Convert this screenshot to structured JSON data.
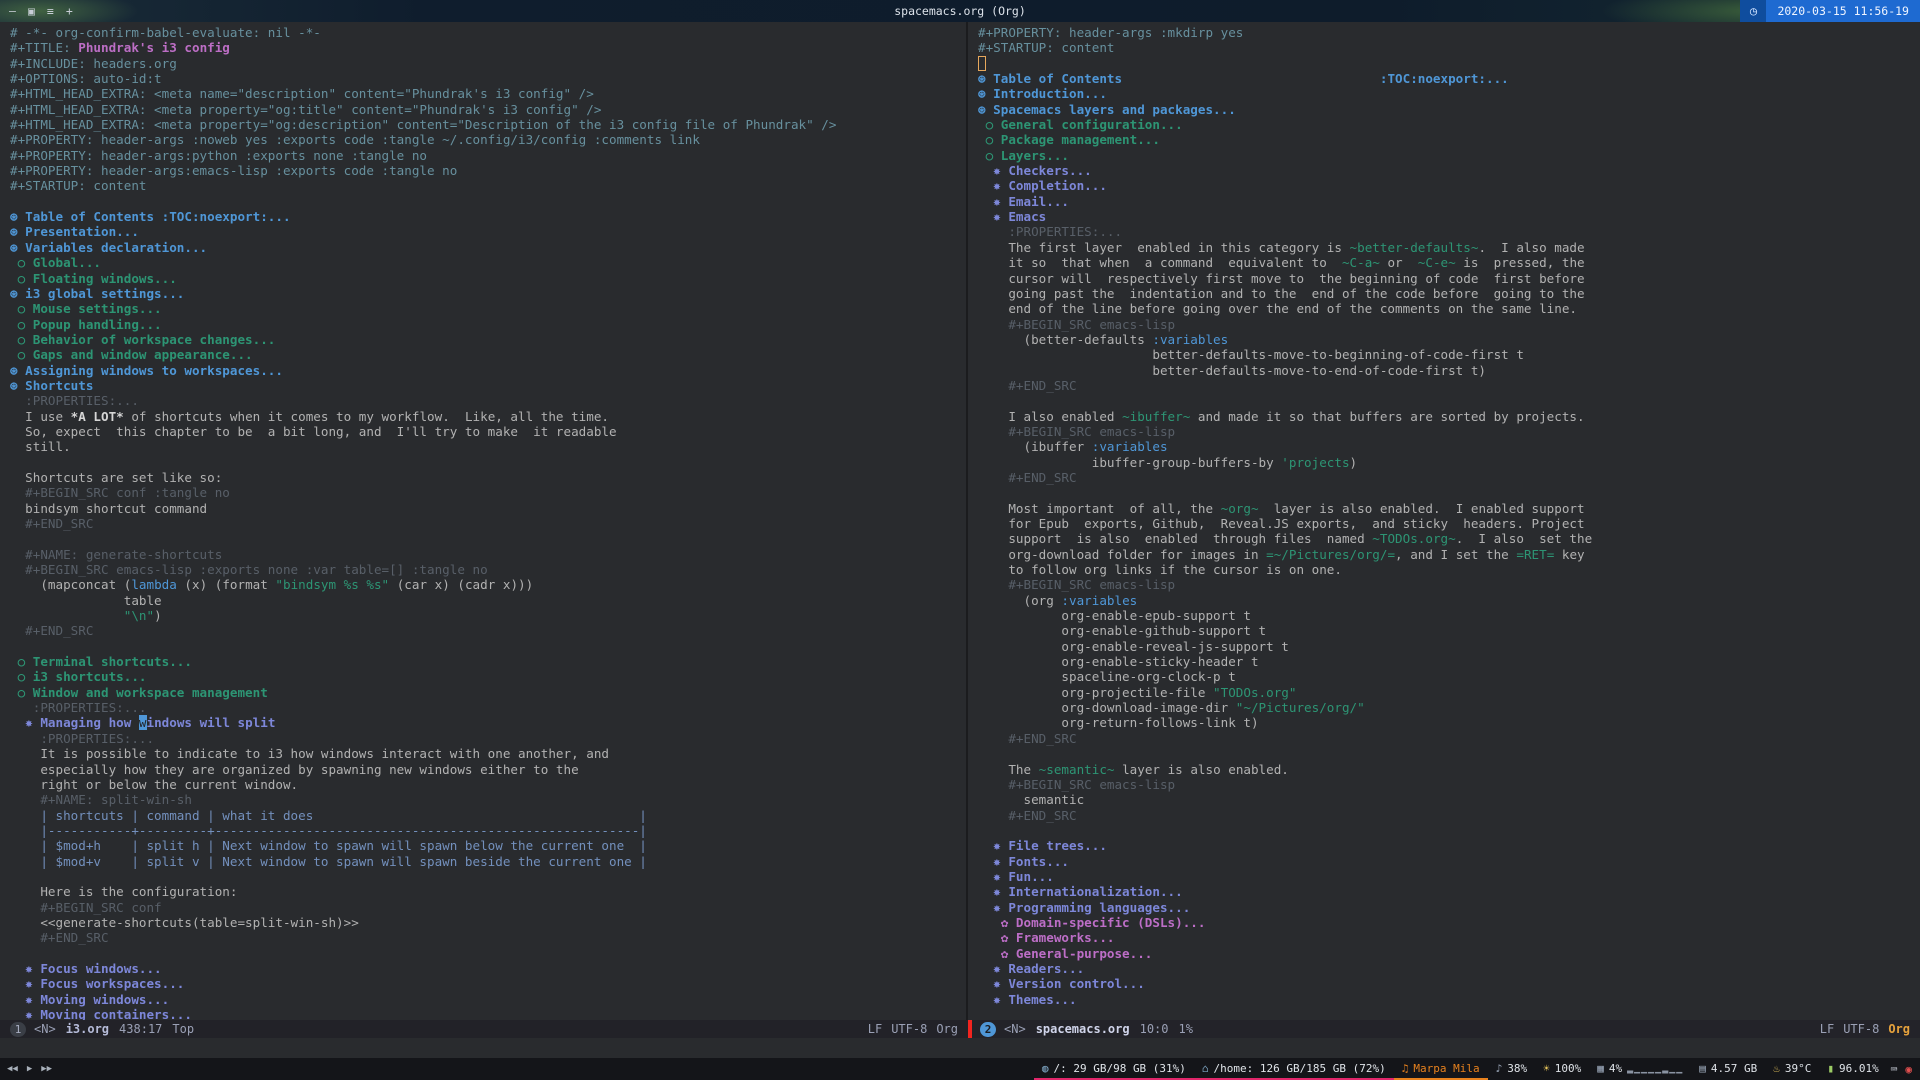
{
  "top_bar": {
    "icons": [
      {
        "name": "minimize-icon",
        "glyph": "—"
      },
      {
        "name": "layout-stacked-icon",
        "glyph": "▣"
      },
      {
        "name": "layout-list-icon",
        "glyph": "≡"
      },
      {
        "name": "new-window-icon",
        "glyph": "+"
      }
    ],
    "title": "spacemacs.org (Org)",
    "clock_icon": "◷",
    "clock_text": "2020-03-15 11:56-19"
  },
  "editor": {
    "left": {
      "modeline": {
        "window": "1",
        "state": "<N>",
        "buffer": "i3.org",
        "position": "438:17",
        "scroll": "Top",
        "eol": "LF",
        "encoding": "UTF-8",
        "mode": "Org"
      },
      "lines": [
        [
          [
            "m",
            "# -*- org-confirm-babel-evaluate: nil -*-"
          ]
        ],
        [
          [
            "m",
            "#+TITLE: "
          ],
          [
            "ti",
            "Phundrak's i3 config"
          ]
        ],
        [
          [
            "m",
            "#+INCLUDE: headers.org"
          ]
        ],
        [
          [
            "m",
            "#+OPTIONS: auto-id:t"
          ]
        ],
        [
          [
            "m",
            "#+HTML_HEAD_EXTRA: <meta name=\"description\" content=\"Phundrak's i3 config\" />"
          ]
        ],
        [
          [
            "m",
            "#+HTML_HEAD_EXTRA: <meta property=\"og:title\" content=\"Phundrak's i3 config\" />"
          ]
        ],
        [
          [
            "m",
            "#+HTML_HEAD_EXTRA: <meta property=\"og:description\" content=\"Description of the i3 config file of Phundrak\" />"
          ]
        ],
        [
          [
            "m",
            "#+PROPERTY: header-args :noweb yes :exports code :tangle ~/.config/i3/config :comments link"
          ]
        ],
        [
          [
            "m",
            "#+PROPERTY: header-args:python :exports none :tangle no"
          ]
        ],
        [
          [
            "m",
            "#+PROPERTY: header-args:emacs-lisp :exports code :tangle no"
          ]
        ],
        [
          [
            "m",
            "#+STARTUP: content"
          ]
        ],
        [],
        [
          [
            "h1",
            "⊛ Table of Contents :TOC:noexport:..."
          ]
        ],
        [
          [
            "h1",
            "⊛ Presentation..."
          ]
        ],
        [
          [
            "h1",
            "⊛ Variables declaration..."
          ]
        ],
        [
          [
            "h2",
            " ○ Global..."
          ]
        ],
        [
          [
            "h2",
            " ○ Floating windows..."
          ]
        ],
        [
          [
            "h1",
            "⊛ i3 global settings..."
          ]
        ],
        [
          [
            "h2",
            " ○ Mouse settings..."
          ]
        ],
        [
          [
            "h2",
            " ○ Popup handling..."
          ]
        ],
        [
          [
            "h2",
            " ○ Behavior of workspace changes..."
          ]
        ],
        [
          [
            "h2",
            " ○ Gaps and window appearance..."
          ]
        ],
        [
          [
            "h1",
            "⊛ Assigning windows to workspaces..."
          ]
        ],
        [
          [
            "h1",
            "⊛ Shortcuts"
          ]
        ],
        [
          [
            "d",
            "  :PROPERTIES:..."
          ]
        ],
        [
          [
            "t",
            "  I use "
          ],
          [
            "b",
            "*A LOT*"
          ],
          [
            "t",
            " of shortcuts when it comes to my workflow.  Like, all the time."
          ]
        ],
        [
          [
            "t",
            "  So, expect  this chapter to be  a bit long, and  I'll try to make  it readable"
          ]
        ],
        [
          [
            "t",
            "  still."
          ]
        ],
        [],
        [
          [
            "t",
            "  Shortcuts are set like so:"
          ]
        ],
        [
          [
            "d",
            "  #+BEGIN_SRC conf :tangle no"
          ]
        ],
        [
          [
            "t",
            "  bindsym shortcut command"
          ]
        ],
        [
          [
            "d",
            "  #+END_SRC"
          ]
        ],
        [],
        [
          [
            "d",
            "  #+NAME: generate-shortcuts"
          ]
        ],
        [
          [
            "d",
            "  #+BEGIN_SRC emacs-lisp :exports none :var table=[] :tangle no"
          ]
        ],
        [
          [
            "t",
            "    (mapconcat ("
          ],
          [
            "k",
            "lambda"
          ],
          [
            "t",
            " (x) (format "
          ],
          [
            "s",
            "\"bindsym %s %s\""
          ],
          [
            "t",
            " (car x) (cadr x)))"
          ]
        ],
        [
          [
            "t",
            "               table"
          ]
        ],
        [
          [
            "t",
            "               "
          ],
          [
            "s",
            "\"\\n\""
          ],
          [
            "t",
            ")"
          ]
        ],
        [
          [
            "d",
            "  #+END_SRC"
          ]
        ],
        [],
        [
          [
            "h2",
            " ○ Terminal shortcuts..."
          ]
        ],
        [
          [
            "h2",
            " ○ i3 shortcuts..."
          ]
        ],
        [
          [
            "h2",
            " ○ Window and workspace management"
          ]
        ],
        [
          [
            "d",
            "   :PROPERTIES:..."
          ]
        ],
        [
          [
            "h3",
            "  ✸ Managing how "
          ],
          [
            "cur",
            "w"
          ],
          [
            "h3",
            "indows will split"
          ]
        ],
        [
          [
            "d",
            "    :PROPERTIES:..."
          ]
        ],
        [
          [
            "t",
            "    It is possible to indicate to i3 how windows interact with one another, and"
          ]
        ],
        [
          [
            "t",
            "    especially how they are organized by spawning new windows either to the"
          ]
        ],
        [
          [
            "t",
            "    right or below the current window."
          ]
        ],
        [
          [
            "d",
            "    #+NAME: split-win-sh"
          ]
        ],
        [
          [
            "tb",
            "    | shortcuts | command | what it does                                           |"
          ]
        ],
        [
          [
            "tb",
            "    |-----------+---------+--------------------------------------------------------|"
          ]
        ],
        [
          [
            "tb",
            "    | $mod+h    | split h | Next window to spawn will spawn below the current one  |"
          ]
        ],
        [
          [
            "tb",
            "    | $mod+v    | split v | Next window to spawn will spawn beside the current one |"
          ]
        ],
        [],
        [
          [
            "t",
            "    Here is the configuration:"
          ]
        ],
        [
          [
            "d",
            "    #+BEGIN_SRC conf"
          ]
        ],
        [
          [
            "t",
            "    <<generate-shortcuts(table=split-win-sh)>>"
          ]
        ],
        [
          [
            "d",
            "    #+END_SRC"
          ]
        ],
        [],
        [
          [
            "h3",
            "  ✸ Focus windows..."
          ]
        ],
        [
          [
            "h3",
            "  ✸ Focus workspaces..."
          ]
        ],
        [
          [
            "h3",
            "  ✸ Moving windows..."
          ]
        ],
        [
          [
            "h3",
            "  ✸ Moving containers..."
          ]
        ]
      ]
    },
    "right": {
      "modeline": {
        "window": "2",
        "state": "<N>",
        "buffer": "spacemacs.org",
        "position": "10:0",
        "scroll": "1%",
        "eol": "LF",
        "encoding": "UTF-8",
        "mode": "Org"
      },
      "lines": [
        [
          [
            "m",
            "#+PROPERTY: header-args :mkdirp yes"
          ]
        ],
        [
          [
            "m",
            "#+STARTUP: content"
          ]
        ],
        [
          [
            "curh",
            " "
          ]
        ],
        [
          [
            "h1",
            "⊛ Table of Contents"
          ],
          [
            "t",
            "                                  "
          ],
          [
            "h1",
            ":TOC:noexport:..."
          ]
        ],
        [
          [
            "h1",
            "⊛ Introduction..."
          ]
        ],
        [
          [
            "h1",
            "⊛ Spacemacs layers and packages..."
          ]
        ],
        [
          [
            "h2",
            " ○ General configuration..."
          ]
        ],
        [
          [
            "h2",
            " ○ Package management..."
          ]
        ],
        [
          [
            "h2",
            " ○ Layers..."
          ]
        ],
        [
          [
            "h3",
            "  ✸ Checkers..."
          ]
        ],
        [
          [
            "h3",
            "  ✸ Completion..."
          ]
        ],
        [
          [
            "h3",
            "  ✸ Email..."
          ]
        ],
        [
          [
            "h3",
            "  ✸ Emacs"
          ]
        ],
        [
          [
            "d",
            "    :PROPERTIES:..."
          ]
        ],
        [
          [
            "t",
            "    The first layer  enabled in this category is "
          ],
          [
            "c",
            "~better-defaults~"
          ],
          [
            "t",
            ".  I also made"
          ]
        ],
        [
          [
            "t",
            "    it so  that when  a command  equivalent to  "
          ],
          [
            "c",
            "~C-a~"
          ],
          [
            "t",
            " or  "
          ],
          [
            "c",
            "~C-e~"
          ],
          [
            "t",
            " is  pressed, the"
          ]
        ],
        [
          [
            "t",
            "    cursor will  respectively first move to  the beginning of code  first before"
          ]
        ],
        [
          [
            "t",
            "    going past the  indentation and to the  end of the code before  going to the"
          ]
        ],
        [
          [
            "t",
            "    end of the line before going over the end of the comments on the same line."
          ]
        ],
        [
          [
            "d",
            "    #+BEGIN_SRC emacs-lisp"
          ]
        ],
        [
          [
            "t",
            "      (better-defaults "
          ],
          [
            "k",
            ":variables"
          ]
        ],
        [
          [
            "t",
            "                       better-defaults-move-to-beginning-of-code-first t"
          ]
        ],
        [
          [
            "t",
            "                       better-defaults-move-to-end-of-code-first t)"
          ]
        ],
        [
          [
            "d",
            "    #+END_SRC"
          ]
        ],
        [],
        [
          [
            "t",
            "    I also enabled "
          ],
          [
            "c",
            "~ibuffer~"
          ],
          [
            "t",
            " and made it so that buffers are sorted by projects."
          ]
        ],
        [
          [
            "d",
            "    #+BEGIN_SRC emacs-lisp"
          ]
        ],
        [
          [
            "t",
            "      (ibuffer "
          ],
          [
            "k",
            ":variables"
          ]
        ],
        [
          [
            "t",
            "               ibuffer-group-buffers-by "
          ],
          [
            "s",
            "'projects"
          ],
          [
            "t",
            ")"
          ]
        ],
        [
          [
            "d",
            "    #+END_SRC"
          ]
        ],
        [],
        [
          [
            "t",
            "    Most important  of all, the "
          ],
          [
            "c",
            "~org~"
          ],
          [
            "t",
            "  layer is also enabled.  I enabled support"
          ]
        ],
        [
          [
            "t",
            "    for Epub  exports, Github,  Reveal.JS exports,  and sticky  headers. Project"
          ]
        ],
        [
          [
            "t",
            "    support  is also  enabled  through files  named "
          ],
          [
            "c",
            "~TODOs.org~"
          ],
          [
            "t",
            ".  I also  set the"
          ]
        ],
        [
          [
            "t",
            "    org-download folder for images in "
          ],
          [
            "c",
            "=~/Pictures/org/="
          ],
          [
            "t",
            ", and I set the "
          ],
          [
            "c",
            "=RET="
          ],
          [
            "t",
            " key"
          ]
        ],
        [
          [
            "t",
            "    to follow org links if the cursor is on one."
          ]
        ],
        [
          [
            "d",
            "    #+BEGIN_SRC emacs-lisp"
          ]
        ],
        [
          [
            "t",
            "      (org "
          ],
          [
            "k",
            ":variables"
          ]
        ],
        [
          [
            "t",
            "           org-enable-epub-support t"
          ]
        ],
        [
          [
            "t",
            "           org-enable-github-support t"
          ]
        ],
        [
          [
            "t",
            "           org-enable-reveal-js-support t"
          ]
        ],
        [
          [
            "t",
            "           org-enable-sticky-header t"
          ]
        ],
        [
          [
            "t",
            "           spaceline-org-clock-p t"
          ]
        ],
        [
          [
            "t",
            "           org-projectile-file "
          ],
          [
            "s",
            "\"TODOs.org\""
          ]
        ],
        [
          [
            "t",
            "           org-download-image-dir "
          ],
          [
            "s",
            "\"~/Pictures/org/\""
          ]
        ],
        [
          [
            "t",
            "           org-return-follows-link t)"
          ]
        ],
        [
          [
            "d",
            "    #+END_SRC"
          ]
        ],
        [],
        [
          [
            "t",
            "    The "
          ],
          [
            "c",
            "~semantic~"
          ],
          [
            "t",
            " layer is also enabled."
          ]
        ],
        [
          [
            "d",
            "    #+BEGIN_SRC emacs-lisp"
          ]
        ],
        [
          [
            "t",
            "      semantic"
          ]
        ],
        [
          [
            "d",
            "    #+END_SRC"
          ]
        ],
        [],
        [
          [
            "h3",
            "  ✸ File trees..."
          ]
        ],
        [
          [
            "h3",
            "  ✸ Fonts..."
          ]
        ],
        [
          [
            "h3",
            "  ✸ Fun..."
          ]
        ],
        [
          [
            "h3",
            "  ✸ Internationalization..."
          ]
        ],
        [
          [
            "h3",
            "  ✸ Programming languages..."
          ]
        ],
        [
          [
            "h4",
            "   ✿ Domain-specific (DSLs)..."
          ]
        ],
        [
          [
            "h4",
            "   ✿ Frameworks..."
          ]
        ],
        [
          [
            "h4",
            "   ✿ General-purpose..."
          ]
        ],
        [
          [
            "h3",
            "  ✸ Readers..."
          ]
        ],
        [
          [
            "h3",
            "  ✸ Version control..."
          ]
        ],
        [
          [
            "h3",
            "  ✸ Themes..."
          ]
        ]
      ]
    }
  },
  "bottom_bar": {
    "player": [
      {
        "name": "previous-icon",
        "glyph": "◀◀",
        "interactable": true
      },
      {
        "name": "play-icon",
        "glyph": "▶",
        "interactable": true
      },
      {
        "name": "next-icon",
        "glyph": "▶▶",
        "interactable": true
      }
    ],
    "modules": [
      {
        "name": "disk-root",
        "icon": "◍",
        "icon_color": "#7ea6c4",
        "text": "/: 29 GB/98 GB (31%)",
        "color": "#dfe3e8",
        "underline": "#e2266b",
        "interactable": false
      },
      {
        "name": "disk-home",
        "icon": "⌂",
        "icon_color": "#7ea6c4",
        "text": "/home: 126 GB/185 GB (72%)",
        "color": "#dfe3e8",
        "underline": "#e2266b",
        "interactable": false
      },
      {
        "name": "mpd-song",
        "icon": "♫",
        "icon_color": "#e8821e",
        "text": "Marpa Mila",
        "color": "#e8821e",
        "underline": "#e8821e",
        "interactable": true
      },
      {
        "name": "volume",
        "icon": "♪",
        "icon_color": "#9aa6b8",
        "text": "38%",
        "color": "#dfe3e8",
        "underline": "",
        "interactable": true
      },
      {
        "name": "brightness",
        "icon": "☀",
        "icon_color": "#e6c45c",
        "text": "100%",
        "color": "#dfe3e8",
        "underline": "",
        "interactable": false
      },
      {
        "name": "cpu",
        "icon": "▦",
        "icon_color": "#9aa6b8",
        "text": "4%",
        "bars": "▂▁▁▁▁▂▁▁",
        "color": "#dfe3e8",
        "underline": "",
        "interactable": false
      },
      {
        "name": "memory",
        "icon": "▤",
        "icon_color": "#9aa6b8",
        "text": "4.57 GB",
        "color": "#dfe3e8",
        "underline": "",
        "interactable": false
      },
      {
        "name": "temperature",
        "icon": "♨",
        "icon_color": "#e6c45c",
        "text": "39°C",
        "color": "#dfe3e8",
        "underline": "",
        "interactable": false
      },
      {
        "name": "battery",
        "icon": "▮",
        "icon_color": "#9ccc65",
        "text": "96.01%",
        "color": "#dfe3e8",
        "underline": "",
        "interactable": false
      }
    ],
    "tray": [
      {
        "name": "keyboard-icon",
        "glyph": "⌨",
        "color": "#d8dee9",
        "interactable": true
      },
      {
        "name": "notification-icon",
        "glyph": "◉",
        "color": "#e34f4f",
        "interactable": true
      }
    ]
  }
}
